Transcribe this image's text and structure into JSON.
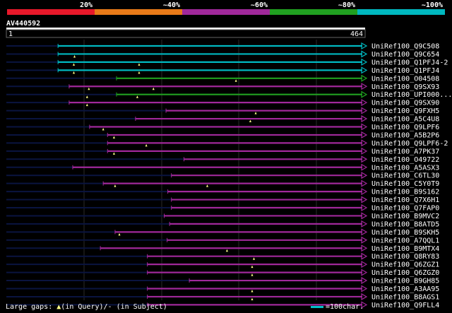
{
  "identity_scale": [
    {
      "label": "20%",
      "color": "#e8182a"
    },
    {
      "label": "~40%",
      "color": "#e87a18"
    },
    {
      "label": "~60%",
      "color": "#a0289a"
    },
    {
      "label": "~80%",
      "color": "#20a020"
    },
    {
      "label": "~100%",
      "color": "#00b8c0"
    }
  ],
  "query": {
    "id": "AV440592",
    "start_label": "1",
    "end_label": "464",
    "length": 464
  },
  "colors": {
    "grid": "#2a2a2a",
    "query_line": "#0a1440",
    "gap_marker": "#ffff88"
  },
  "hits": [
    {
      "name": "UniRef100_Q9C508",
      "color": "#00b8c0",
      "start": 144,
      "gaps_q": []
    },
    {
      "name": "UniRef100_Q9C654",
      "color": "#00b8c0",
      "start": 144,
      "gaps_q": [
        190
      ]
    },
    {
      "name": "UniRef100_Q1PFJ4-2",
      "color": "#00b8c0",
      "start": 144,
      "gaps_q": [
        188,
        370
      ]
    },
    {
      "name": "UniRef100_Q1PFJ4",
      "color": "#00b8c0",
      "start": 144,
      "gaps_q": [
        188,
        370
      ]
    },
    {
      "name": "UniRef100_O04508",
      "color": "#20a020",
      "start": 307,
      "gaps_q": [
        640
      ]
    },
    {
      "name": "UniRef100_Q9SX93",
      "color": "#a0289a",
      "start": 175,
      "gaps_q": [
        230,
        410
      ]
    },
    {
      "name": "UniRef100_UPI000...",
      "color": "#20a020",
      "start": 307,
      "gaps_q": [
        225,
        365
      ]
    },
    {
      "name": "UniRef100_Q9SX90",
      "color": "#a0289a",
      "start": 175,
      "gaps_q": [
        225
      ]
    },
    {
      "name": "UniRef100_Q9FXH5",
      "color": "#a0289a",
      "start": 445,
      "gaps_q": [
        695
      ]
    },
    {
      "name": "UniRef100_A5C4U8",
      "color": "#a0289a",
      "start": 360,
      "gaps_q": [
        680
      ]
    },
    {
      "name": "UniRef100_Q9LPF6",
      "color": "#a0289a",
      "start": 232,
      "gaps_q": [
        270
      ]
    },
    {
      "name": "UniRef100_A5B2P6",
      "color": "#a0289a",
      "start": 282,
      "gaps_q": [
        300
      ]
    },
    {
      "name": "UniRef100_Q9LPF6-2",
      "color": "#a0289a",
      "start": 282,
      "gaps_q": [
        390
      ]
    },
    {
      "name": "UniRef100_A7PK37",
      "color": "#a0289a",
      "start": 282,
      "gaps_q": [
        300
      ]
    },
    {
      "name": "UniRef100_O49722",
      "color": "#a0289a",
      "start": 495,
      "gaps_q": []
    },
    {
      "name": "UniRef100_A5ASX3",
      "color": "#a0289a",
      "start": 185,
      "gaps_q": []
    },
    {
      "name": "UniRef100_C6TL30",
      "color": "#a0289a",
      "start": 460,
      "gaps_q": []
    },
    {
      "name": "UniRef100_C5Y0T9",
      "color": "#a0289a",
      "start": 270,
      "gaps_q": [
        303,
        560
      ]
    },
    {
      "name": "UniRef100_B9S162",
      "color": "#a0289a",
      "start": 450,
      "gaps_q": []
    },
    {
      "name": "UniRef100_Q7X6H1",
      "color": "#a0289a",
      "start": 460,
      "gaps_q": []
    },
    {
      "name": "UniRef100_Q7FAP0",
      "color": "#a0289a",
      "start": 460,
      "gaps_q": []
    },
    {
      "name": "UniRef100_B9MVC2",
      "color": "#a0289a",
      "start": 440,
      "gaps_q": []
    },
    {
      "name": "UniRef100_B8ATD5",
      "color": "#a0289a",
      "start": 455,
      "gaps_q": []
    },
    {
      "name": "UniRef100_B9SKH5",
      "color": "#a0289a",
      "start": 303,
      "gaps_q": [
        315
      ]
    },
    {
      "name": "UniRef100_A7QQL1",
      "color": "#a0289a",
      "start": 448,
      "gaps_q": []
    },
    {
      "name": "UniRef100_B9MTX4",
      "color": "#a0289a",
      "start": 262,
      "gaps_q": [
        615
      ]
    },
    {
      "name": "UniRef100_Q8RY83",
      "color": "#a0289a",
      "start": 393,
      "gaps_q": [
        690
      ]
    },
    {
      "name": "UniRef100_Q6ZGZ1",
      "color": "#a0289a",
      "start": 393,
      "gaps_q": [
        685
      ]
    },
    {
      "name": "UniRef100_Q6ZGZ0",
      "color": "#a0289a",
      "start": 393,
      "gaps_q": [
        685
      ]
    },
    {
      "name": "UniRef100_B9GH85",
      "color": "#a0289a",
      "start": 510,
      "gaps_q": []
    },
    {
      "name": "UniRef100_A3AA95",
      "color": "#a0289a",
      "start": 393,
      "gaps_q": [
        685
      ]
    },
    {
      "name": "UniRef100_B8AGS1",
      "color": "#a0289a",
      "start": 393,
      "gaps_q": [
        685
      ]
    },
    {
      "name": "UniRef100_Q9FLL4",
      "color": "#a0289a",
      "start": 393,
      "gaps_q": []
    }
  ],
  "footer": {
    "gaps_prefix": "Large gaps:",
    "gaps_query": "(in Query)/",
    "gaps_subject": "- (in Subject)",
    "scale_label": "=100char."
  }
}
